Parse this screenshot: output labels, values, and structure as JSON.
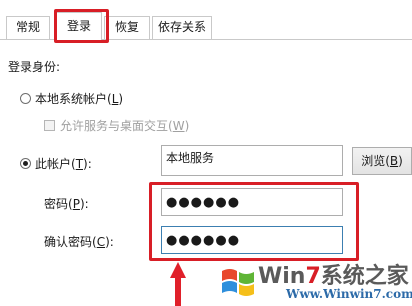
{
  "tabs": [
    {
      "label": "常规",
      "active": false
    },
    {
      "label": "登录",
      "active": true
    },
    {
      "label": "恢复",
      "active": false
    },
    {
      "label": "依存关系",
      "active": false
    }
  ],
  "login": {
    "section_label": "登录身份:",
    "local_system": {
      "label": "本地系统帐户(",
      "key": "L",
      "suffix": ")",
      "selected": false
    },
    "interact_desktop": {
      "label": "允许服务与桌面交互(",
      "key": "W",
      "suffix": ")",
      "checked": false,
      "enabled": false
    },
    "this_account": {
      "label": "此帐户(",
      "key": "T",
      "suffix": "):",
      "selected": true,
      "value": "本地服务"
    },
    "browse_button": {
      "label": "浏览(",
      "key": "B",
      "suffix": ")"
    },
    "password": {
      "label": "密码(",
      "key": "P",
      "suffix": "):",
      "value": "●●●●●●"
    },
    "confirm_password": {
      "label": "确认密码(",
      "key": "C",
      "suffix": "):",
      "value": "●●●●●●"
    }
  },
  "watermark": {
    "brand_win": "Win",
    "brand_seven": "7",
    "brand_rest": "系统之家",
    "url": "Www.Winwin7.com"
  },
  "colors": {
    "highlight_red": "#d81e26",
    "focus_blue": "#3c7fb1",
    "logo_red": "#e8482c",
    "logo_green": "#5fb536",
    "logo_blue": "#2f8fdc",
    "logo_yellow": "#f5bf1a"
  }
}
